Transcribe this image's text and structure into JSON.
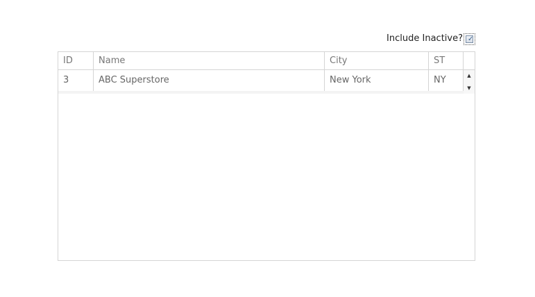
{
  "filter": {
    "include_inactive_label": "Include Inactive?",
    "include_inactive_checked": true
  },
  "grid": {
    "columns": [
      "ID",
      "Name",
      "City",
      "ST"
    ],
    "rows": [
      {
        "id": "3",
        "name": "ABC Superstore",
        "city": "New York",
        "st": "NY"
      }
    ]
  },
  "icons": {
    "checkmark": "check-icon",
    "scroll_up": "arrow-up-icon",
    "scroll_down": "arrow-down-icon"
  }
}
